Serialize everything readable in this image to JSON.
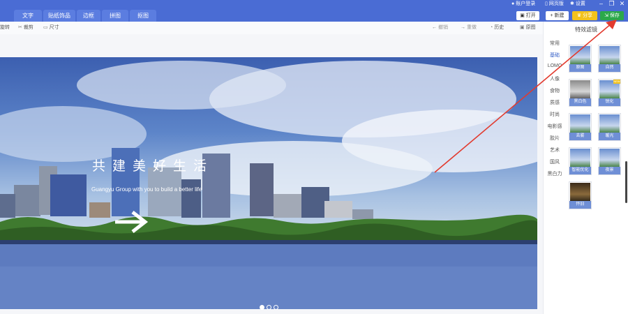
{
  "titlebar": {
    "tabs": [
      "文字",
      "贴纸饰品",
      "边框",
      "拼图",
      "抠图"
    ],
    "account": "账户登录",
    "web_version": "网页版",
    "settings": "设置",
    "open_label": "打开",
    "new_label": "新建",
    "share_label": "分享",
    "save_label": "保存"
  },
  "toolbar": {
    "rotate": "旋转",
    "crop": "裁剪",
    "size": "尺寸",
    "undo": "撤销",
    "redo": "重做",
    "history": "历史",
    "original": "原图"
  },
  "photo": {
    "headline": "共建美好生活",
    "subline": "Guangyu Group with you to build a better life"
  },
  "panel": {
    "title": "特效滤镜",
    "categories": [
      "常用",
      "基础",
      "LOMO",
      "人像",
      "食物",
      "质感",
      "时尚",
      "电影感",
      "胶片",
      "艺术",
      "国风",
      "黑白力"
    ],
    "filters": [
      "原图",
      "自然",
      "黑白色",
      "锐化",
      "去雾",
      "暖光",
      "智能优化",
      "夜景",
      "怀旧"
    ],
    "badge": "NEW"
  },
  "colors": {
    "titlebar": "#4a6cd4",
    "save": "#2ba84a",
    "share": "#f3c21c",
    "annotation": "#e23a2e"
  }
}
